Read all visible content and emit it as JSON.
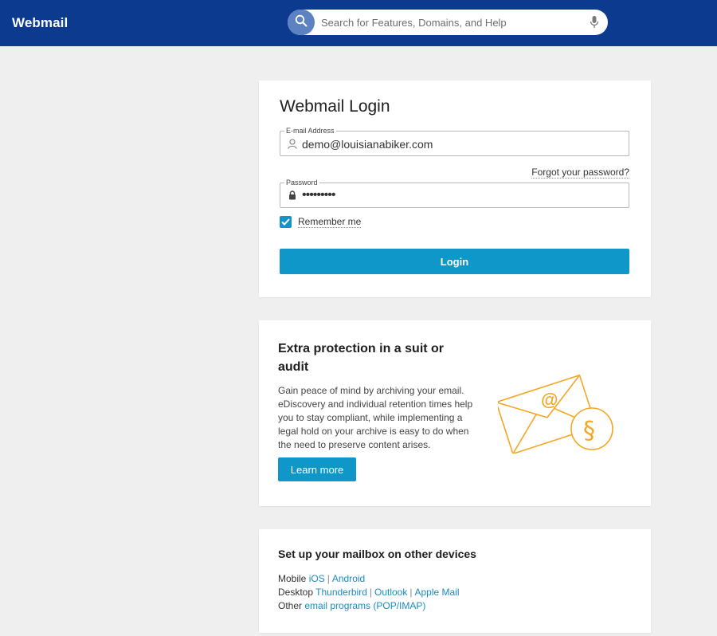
{
  "header": {
    "brand": "Webmail",
    "search_placeholder": "Search for Features, Domains, and Help"
  },
  "login": {
    "title": "Webmail Login",
    "email_label": "E-mail Address",
    "email_value": "demo@louisianabiker.com",
    "forgot_link": "Forgot your password?",
    "password_label": "Password",
    "password_value": "•••••••••",
    "remember_label": "Remember me",
    "remember_checked": true,
    "login_button": "Login"
  },
  "promo": {
    "title": "Extra protection in a suit or audit",
    "body": "Gain peace of mind by archiving your email. eDiscovery and individual retention times help you to stay compliant, while implementing a legal hold on your archive is easy to do when the need to preserve content arises.",
    "button": "Learn more",
    "accent": "#f5a623"
  },
  "devices": {
    "title": "Set up your mailbox on other devices",
    "rows": [
      {
        "label": "Mobile",
        "links": [
          "iOS",
          "Android"
        ]
      },
      {
        "label": "Desktop",
        "links": [
          "Thunderbird",
          "Outlook",
          "Apple Mail"
        ]
      },
      {
        "label": "Other",
        "links": [
          "email programs (POP/IMAP)"
        ]
      }
    ]
  },
  "colors": {
    "header_bg": "#0b3a8f",
    "primary_button": "#0f97c9",
    "link": "#1a8cc4"
  },
  "icons": [
    "search-icon",
    "microphone-icon",
    "user-icon",
    "lock-icon",
    "check-icon",
    "envelope-archive-icon"
  ]
}
